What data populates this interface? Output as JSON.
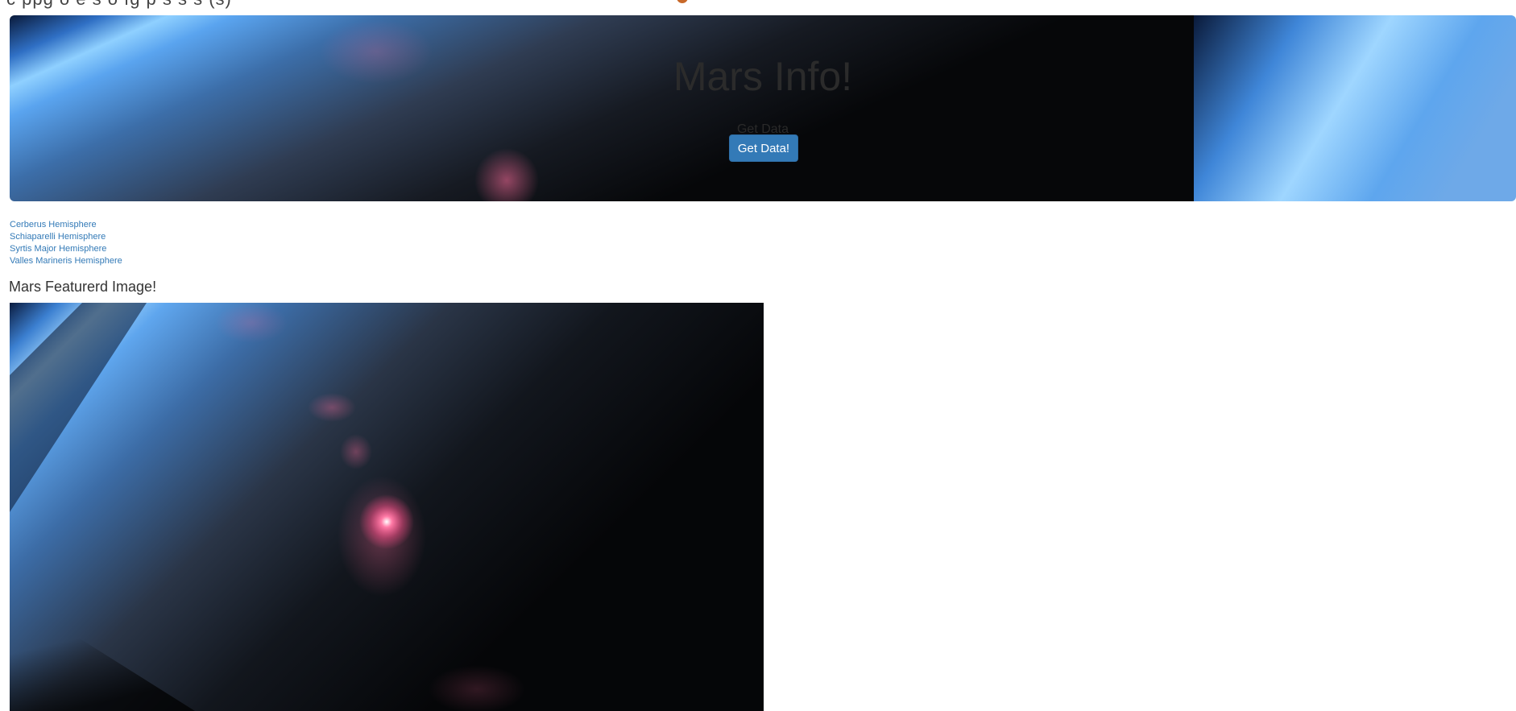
{
  "top_strip": {
    "clipped_text": "c ppg o e s  o  fg  p             s              s      s    (s)  "
  },
  "hero": {
    "title": "Mars Info!",
    "subtitle": "Get Data",
    "button_label": "Get Data!"
  },
  "hemispheres": [
    {
      "label": "Cerberus Hemisphere"
    },
    {
      "label": "Schiaparelli Hemisphere"
    },
    {
      "label": "Syrtis Major Hemisphere"
    },
    {
      "label": "Valles Marineris Hemisphere"
    }
  ],
  "featured": {
    "heading": "Mars Featurerd Image!"
  },
  "colors": {
    "link": "#337ab7",
    "button": "#337ab7",
    "glow_blue": "#7ec5ff",
    "space_dark": "#05070c",
    "flare_pink": "#ff4f8a"
  }
}
